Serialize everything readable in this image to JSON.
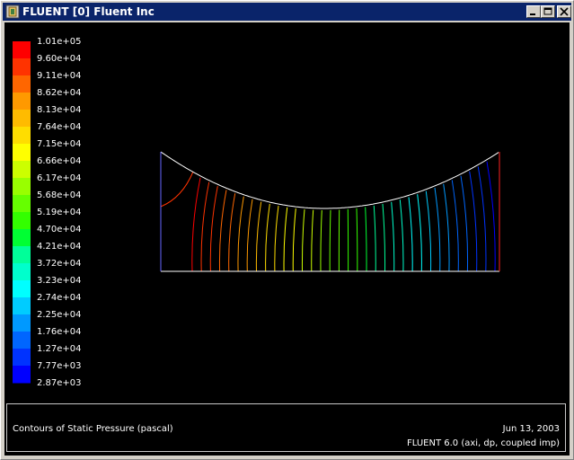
{
  "window": {
    "title": "FLUENT [0] Fluent Inc",
    "controls": [
      "minimize-icon",
      "maximize-icon",
      "close-icon"
    ]
  },
  "colorbar": {
    "labels": [
      "1.01e+05",
      "9.60e+04",
      "9.11e+04",
      "8.62e+04",
      "8.13e+04",
      "7.64e+04",
      "7.15e+04",
      "6.66e+04",
      "6.17e+04",
      "5.68e+04",
      "5.19e+04",
      "4.70e+04",
      "4.21e+04",
      "3.72e+04",
      "3.23e+04",
      "2.74e+04",
      "2.25e+04",
      "1.76e+04",
      "1.27e+04",
      "7.77e+03",
      "2.87e+03"
    ],
    "colors": [
      "#ff0000",
      "#ff3300",
      "#ff6600",
      "#ff9900",
      "#ffbb00",
      "#ffdd00",
      "#ffff00",
      "#ccff00",
      "#99ff00",
      "#66ff00",
      "#33ff00",
      "#00ff33",
      "#00ff99",
      "#00ffcc",
      "#00ffff",
      "#00ccff",
      "#0099ff",
      "#0066ff",
      "#0033ff",
      "#0000ff"
    ]
  },
  "caption": {
    "title": "Contours of Static Pressure (pascal)",
    "date": "Jun 13, 2003",
    "version": "FLUENT 6.0 (axi, dp, coupled imp)"
  }
}
